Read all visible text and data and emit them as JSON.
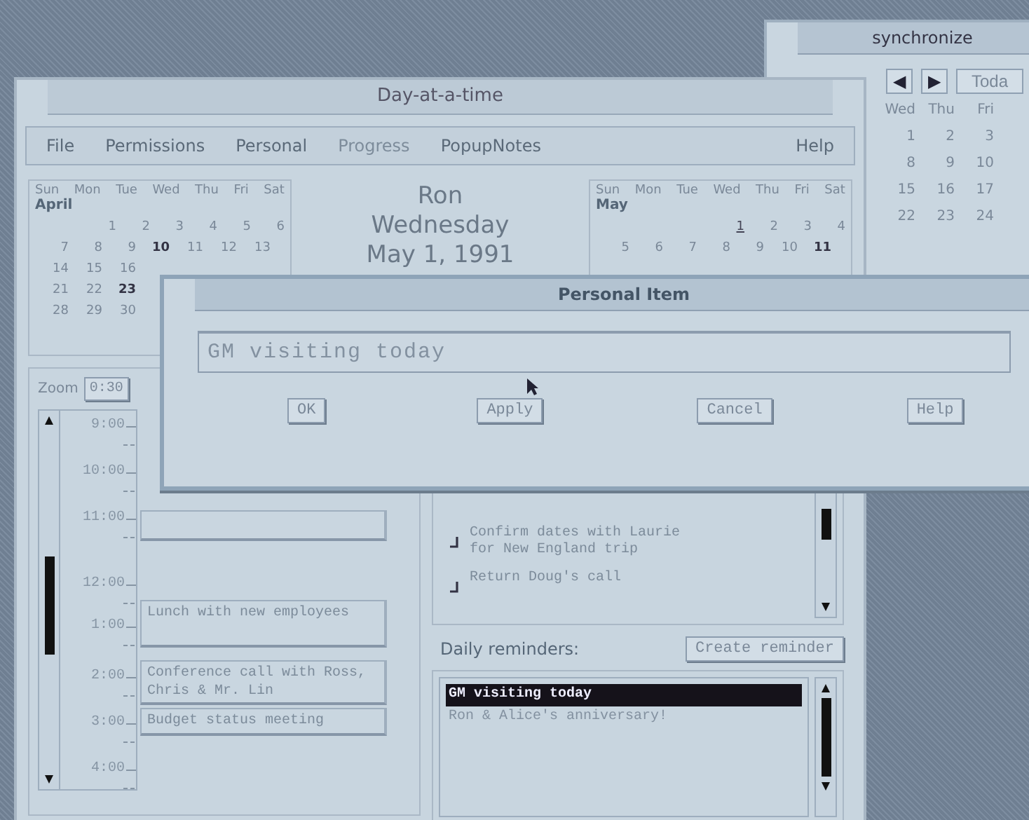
{
  "back_window": {
    "title": "synchronize",
    "nav": [
      "◀",
      "▶"
    ],
    "today_button": "Toda",
    "weekdays": [
      "Wed",
      "Thu",
      "Fri"
    ],
    "weeks": [
      [
        "1",
        "2",
        "3"
      ],
      [
        "8",
        "9",
        "10"
      ],
      [
        "15",
        "16",
        "17"
      ],
      [
        "22",
        "23",
        "24"
      ]
    ]
  },
  "window": {
    "title": "Day-at-a-time"
  },
  "menu": [
    {
      "label": "File",
      "disabled": false
    },
    {
      "label": "Permissions",
      "disabled": false
    },
    {
      "label": "Personal",
      "disabled": false
    },
    {
      "label": "Progress",
      "disabled": true
    },
    {
      "label": "PopupNotes",
      "disabled": false
    },
    {
      "label": "Help",
      "disabled": false
    }
  ],
  "calendars": [
    {
      "weekdays": [
        "Sun",
        "Mon",
        "Tue",
        "Wed",
        "Thu",
        "Fri",
        "Sat"
      ],
      "month": "April",
      "weeks": [
        [
          {
            "day": "1",
            "bold": false,
            "selected": false
          },
          {
            "day": "2",
            "bold": false,
            "selected": false
          },
          {
            "day": "3",
            "bold": false,
            "selected": false
          },
          {
            "day": "4",
            "bold": false,
            "selected": false
          },
          {
            "day": "5",
            "bold": false,
            "selected": false
          },
          {
            "day": "6",
            "bold": false,
            "selected": false
          }
        ],
        [
          {
            "day": "7",
            "bold": false,
            "selected": false
          },
          {
            "day": "8",
            "bold": false,
            "selected": false
          },
          {
            "day": "9",
            "bold": false,
            "selected": false
          },
          {
            "day": "10",
            "bold": true,
            "selected": false
          },
          {
            "day": "11",
            "bold": false,
            "selected": false
          },
          {
            "day": "12",
            "bold": false,
            "selected": false
          },
          {
            "day": "13",
            "bold": false,
            "selected": false
          }
        ],
        [
          {
            "day": "14",
            "bold": false,
            "selected": false
          },
          {
            "day": "15",
            "bold": false,
            "selected": false
          },
          {
            "day": "16",
            "bold": false,
            "selected": false
          }
        ],
        [
          {
            "day": "21",
            "bold": false,
            "selected": false
          },
          {
            "day": "22",
            "bold": false,
            "selected": false
          },
          {
            "day": "23",
            "bold": true,
            "selected": false
          }
        ],
        [
          {
            "day": "28",
            "bold": false,
            "selected": false
          },
          {
            "day": "29",
            "bold": false,
            "selected": false
          },
          {
            "day": "30",
            "bold": false,
            "selected": false
          }
        ]
      ]
    },
    {
      "weekdays": [
        "Sun",
        "Mon",
        "Tue",
        "Wed",
        "Thu",
        "Fri",
        "Sat"
      ],
      "month": "May",
      "weeks": [
        [
          {
            "day": "1",
            "bold": false,
            "selected": true
          },
          {
            "day": "2",
            "bold": false,
            "selected": false
          },
          {
            "day": "3",
            "bold": false,
            "selected": false
          },
          {
            "day": "4",
            "bold": false,
            "selected": false
          }
        ],
        [
          {
            "day": "5",
            "bold": false,
            "selected": false
          },
          {
            "day": "6",
            "bold": false,
            "selected": false
          },
          {
            "day": "7",
            "bold": false,
            "selected": false
          },
          {
            "day": "8",
            "bold": false,
            "selected": false
          },
          {
            "day": "9",
            "bold": false,
            "selected": false
          },
          {
            "day": "10",
            "bold": false,
            "selected": false
          },
          {
            "day": "11",
            "bold": true,
            "selected": false
          }
        ]
      ]
    }
  ],
  "heading": {
    "user": "Ron",
    "weekday": "Wednesday",
    "date": "May 1, 1991"
  },
  "zoom": {
    "label": "Zoom",
    "value": "0:30"
  },
  "times": [
    "9:00",
    "10:00",
    "11:00",
    "12:00",
    "1:00",
    "2:00",
    "3:00",
    "4:00"
  ],
  "appointments": [
    "Lunch with new employees",
    "Conference call with Ross, Chris & Mr. Lin",
    "Budget status meeting"
  ],
  "todos": [
    {
      "text": "Confirm dates with Laurie for New England trip",
      "checked": true
    },
    {
      "text": "Return Doug's call",
      "checked": true
    }
  ],
  "reminders": {
    "label": "Daily reminders:",
    "button": "Create reminder",
    "items": [
      {
        "text": "GM visiting today",
        "selected": true
      },
      {
        "text": "Ron & Alice's anniversary!",
        "selected": false
      }
    ]
  },
  "dialog": {
    "title": "Personal Item",
    "value": "GM visiting today",
    "buttons": [
      "OK",
      "Apply",
      "Cancel",
      "Help"
    ]
  }
}
